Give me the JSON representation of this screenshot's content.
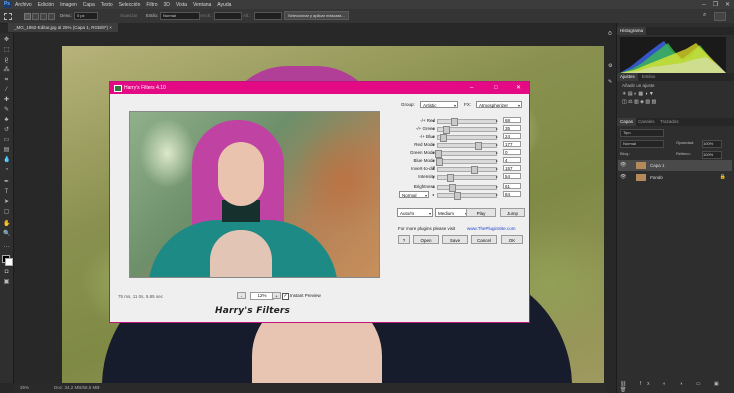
{
  "menubar": {
    "logo": "Ps",
    "items": [
      "Archivo",
      "Edición",
      "Imagen",
      "Capa",
      "Texto",
      "Selección",
      "Filtro",
      "3D",
      "Vista",
      "Ventana",
      "Ayuda"
    ]
  },
  "optionsbar": {
    "blur_label": "Desv.:",
    "blur_value": "0 px",
    "smooth_label": "Suavizar",
    "style_label": "Estilo:",
    "style_value": "Normal",
    "width_label": "Anch.:",
    "height_label": "Alt.:",
    "select_mask_button": "Seleccionar y aplicar máscara..."
  },
  "document": {
    "tab_title": "_MG_1982-Editar.jpg al 25% (Capa 1, RGB/8*) ×"
  },
  "status": {
    "zoom": "25%",
    "doc_info": "Doc: 34,2 MB/68,5 MB"
  },
  "panels": {
    "histogram_tab": "Histograma",
    "adjust_tabs": [
      "Ajustes",
      "Estilos"
    ],
    "add_adjustment": "Añadir un ajuste",
    "layers_tabs": [
      "Capas",
      "Canales",
      "Trazados"
    ],
    "kind_filter": "Tipo",
    "blend_mode": "Normal",
    "opacity_label": "Opacidad:",
    "opacity_value": "100%",
    "lock_label": "Bloq.:",
    "fill_label": "Relleno:",
    "fill_value": "100%",
    "layers": [
      {
        "name": "Capa 1"
      },
      {
        "name": "Fondo"
      }
    ]
  },
  "dialog": {
    "title": "Harry's Filters 4.10",
    "group_label": "Group:",
    "group_value": "Artistic",
    "fx_label": "FX:",
    "fx_value": "Atmospherizer",
    "sliders": [
      {
        "label": "-/+ Red",
        "value": "68",
        "pos": 0.27
      },
      {
        "label": "-/+ Green",
        "value": "35",
        "pos": 0.14
      },
      {
        "label": "-/+ Blue",
        "value": "24",
        "pos": 0.09
      },
      {
        "label": "Red Mode",
        "value": "177",
        "pos": 0.69
      },
      {
        "label": "Green Mode",
        "value": "0",
        "pos": 0.0
      },
      {
        "label": "Blue Mode",
        "value": "4",
        "pos": 0.02
      },
      {
        "label": "Invert-to-diff",
        "value": "157",
        "pos": 0.62
      },
      {
        "label": "Intensity",
        "value": "54",
        "pos": 0.21
      },
      {
        "label": "Brightness",
        "value": "61",
        "pos": 0.24
      }
    ],
    "blend_value": "Normal",
    "blend_amount": "84",
    "blend_pos": 0.33,
    "auto_value": "Auto/rs",
    "speed_value": "Medium",
    "play_button": "Play",
    "jump_button": "Jump",
    "more_text": "For more plugins please visit",
    "link_text": "www.ThePluginSite.com",
    "help_button": "?",
    "open_button": "Open",
    "save_button": "Save",
    "cancel_button": "Cancel",
    "ok_button": "OK",
    "timing": "75 ms, 11 0s, 5.85 sec",
    "zoom_minus": "-",
    "zoom_value": "12%",
    "zoom_plus": "+",
    "instant_preview": "Instant Preview",
    "logo_text": "Harry's Filters"
  }
}
